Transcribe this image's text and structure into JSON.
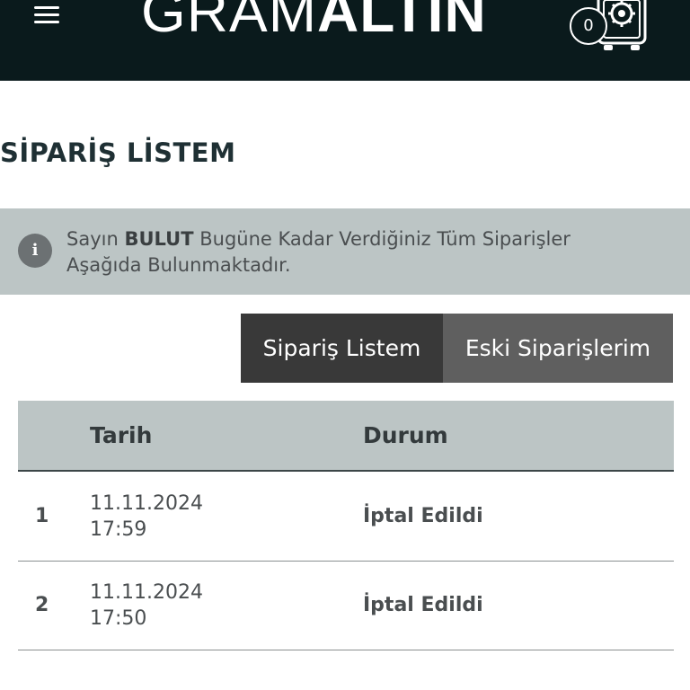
{
  "header": {
    "logo_light": "GRAM",
    "logo_bold": "ALTIN",
    "cart_count": "0"
  },
  "page": {
    "title": "SİPARİŞ LİSTEM"
  },
  "info": {
    "icon": "i",
    "prefix": "Sayın",
    "name": "BULUT",
    "message_line1": " Bugüne Kadar Verdiğiniz Tüm Siparişler",
    "message_line2": "Aşağıda Bulunmaktadır."
  },
  "tabs": [
    {
      "label": "Sipariş Listem",
      "active": true
    },
    {
      "label": "Eski Siparişlerim",
      "active": false
    }
  ],
  "table": {
    "headers": {
      "no": "",
      "date": "Tarih",
      "status": "Durum"
    },
    "rows": [
      {
        "no": "1",
        "date": "11.11.2024",
        "time": "17:59",
        "status": "İptal Edildi"
      },
      {
        "no": "2",
        "date": "11.11.2024",
        "time": "17:50",
        "status": "İptal Edildi"
      }
    ]
  },
  "colors": {
    "header_bg": "#0a1a1c",
    "banner_bg": "#bcc5c5",
    "tab_active": "#393939",
    "tab_inactive": "#5f5f5f"
  }
}
